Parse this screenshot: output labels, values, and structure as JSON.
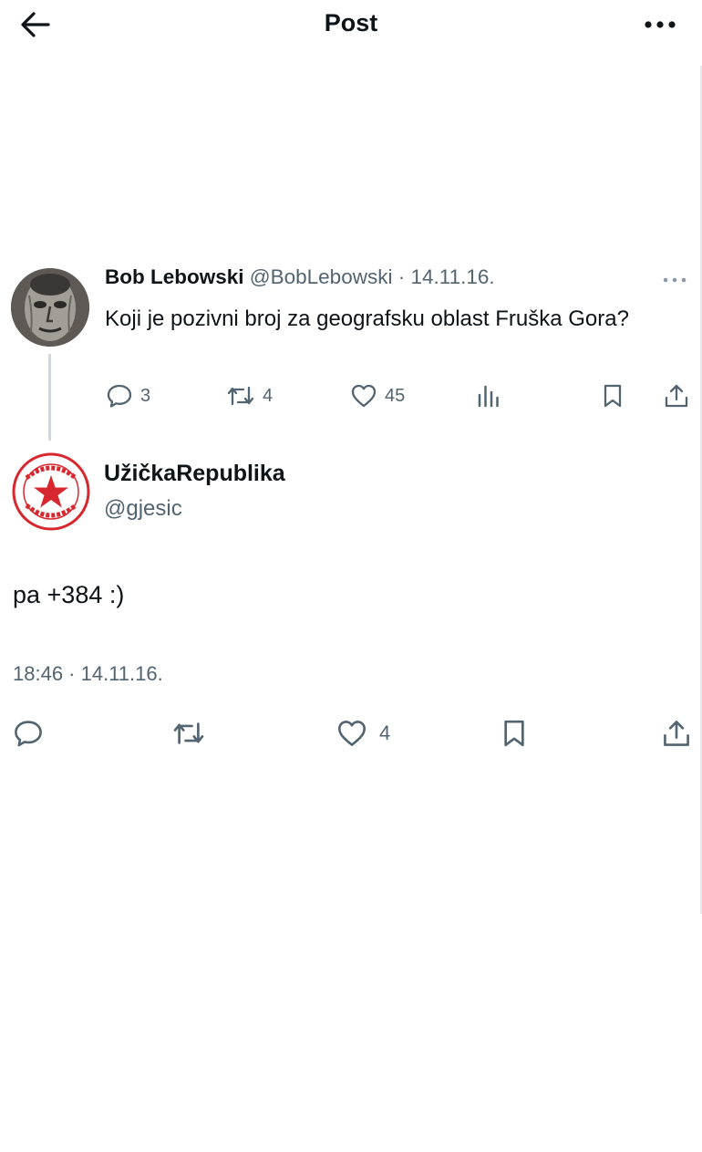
{
  "header": {
    "title": "Post",
    "back_icon": "arrow-left-icon",
    "more_icon": "more-horizontal-icon"
  },
  "parent_tweet": {
    "display_name": "Bob Lebowski",
    "handle": "@BobLebowski",
    "separator": "·",
    "date": "14.11.16.",
    "text": "Koji je pozivni broj za geografsku oblast Fruška Gora?",
    "actions": {
      "replies": "3",
      "retweets": "4",
      "likes": "45"
    }
  },
  "reply_tweet": {
    "display_name": "UžičkaRepublika",
    "handle": "@gjesic",
    "text": "pa +384 :)",
    "timestamp": "18:46 · 14.11.16.",
    "actions": {
      "likes": "4"
    }
  },
  "colors": {
    "text_primary": "#0f1419",
    "text_secondary": "#536471",
    "thread_line": "#cfd9de",
    "logo_red": "#d7282f"
  }
}
